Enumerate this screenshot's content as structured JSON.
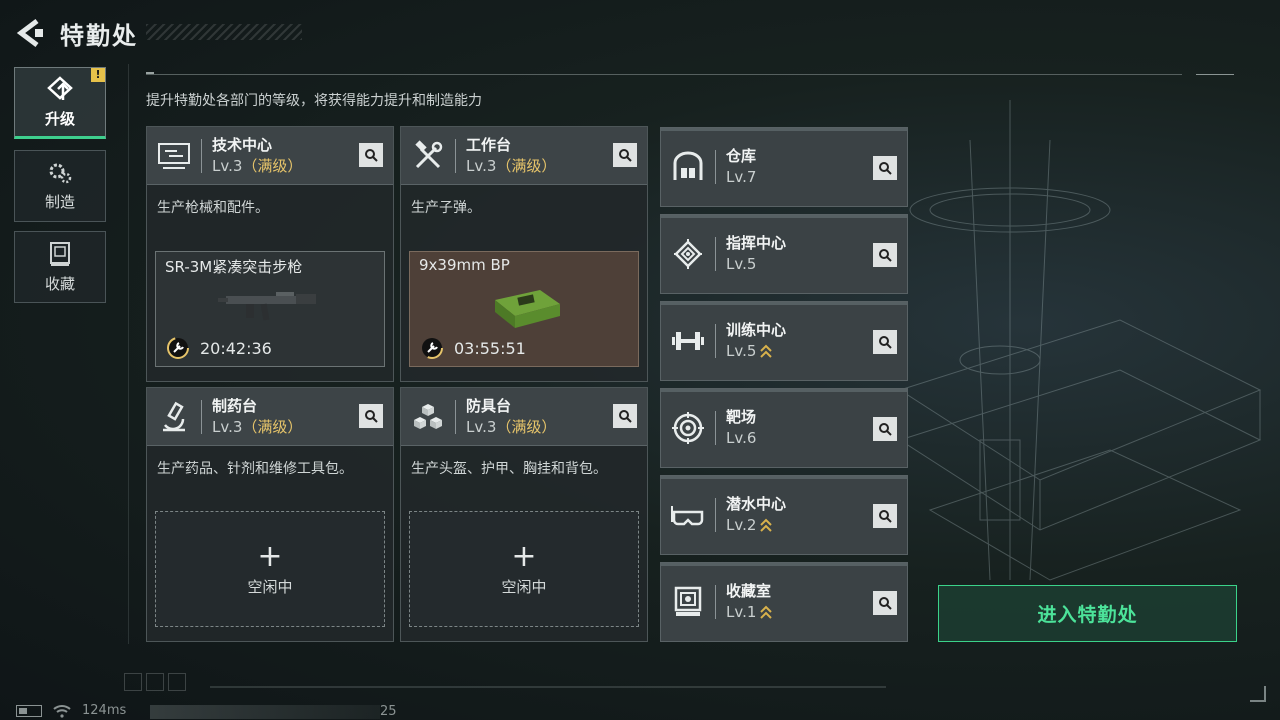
{
  "header": {
    "title": "特勤处"
  },
  "nav": [
    {
      "label": "升级",
      "icon": "upgrade-icon",
      "active": true,
      "badge": "!"
    },
    {
      "label": "制造",
      "icon": "gears-icon",
      "active": false
    },
    {
      "label": "收藏",
      "icon": "collection-icon",
      "active": false
    }
  ],
  "subtitle": "提升特勤处各部门的等级，将获得能力提升和制造能力",
  "cards": [
    {
      "name": "技术中心",
      "level": "Lv.3",
      "max": "（满级）",
      "desc": "生产枪械和配件。",
      "icon": "monitor-icon",
      "product": {
        "name": "SR-3M紧凑突击步枪",
        "timer": "20:42:36"
      }
    },
    {
      "name": "工作台",
      "level": "Lv.3",
      "max": "（满级）",
      "desc": "生产子弹。",
      "icon": "tools-icon",
      "product": {
        "name": "9x39mm BP",
        "timer": "03:55:51"
      }
    },
    {
      "name": "制药台",
      "level": "Lv.3",
      "max": "（满级）",
      "desc": "生产药品、针剂和维修工具包。",
      "icon": "microscope-icon",
      "idle": {
        "plus": "+",
        "label": "空闲中"
      }
    },
    {
      "name": "防具台",
      "level": "Lv.3",
      "max": "（满级）",
      "desc": "生产头盔、护甲、胸挂和背包。",
      "icon": "cubes-icon",
      "idle": {
        "plus": "+",
        "label": "空闲中"
      }
    }
  ],
  "small_cards": [
    {
      "name": "仓库",
      "level": "Lv.7",
      "icon": "warehouse-icon",
      "upgradable": false
    },
    {
      "name": "指挥中心",
      "level": "Lv.5",
      "icon": "chip-icon",
      "upgradable": false
    },
    {
      "name": "训练中心",
      "level": "Lv.5",
      "icon": "dumbbell-icon",
      "upgradable": true
    },
    {
      "name": "靶场",
      "level": "Lv.6",
      "icon": "target-icon",
      "upgradable": false
    },
    {
      "name": "潜水中心",
      "level": "Lv.2",
      "icon": "goggles-icon",
      "upgradable": true
    },
    {
      "name": "收藏室",
      "level": "Lv.1",
      "icon": "showcase-icon",
      "upgradable": true
    }
  ],
  "enter_button": "进入特勤处",
  "status": {
    "ping": "124ms",
    "count": "25"
  },
  "colors": {
    "accent": "#3ecf8e",
    "max_level": "#e6c46a",
    "upgrade_arrow": "#d9b24c"
  }
}
